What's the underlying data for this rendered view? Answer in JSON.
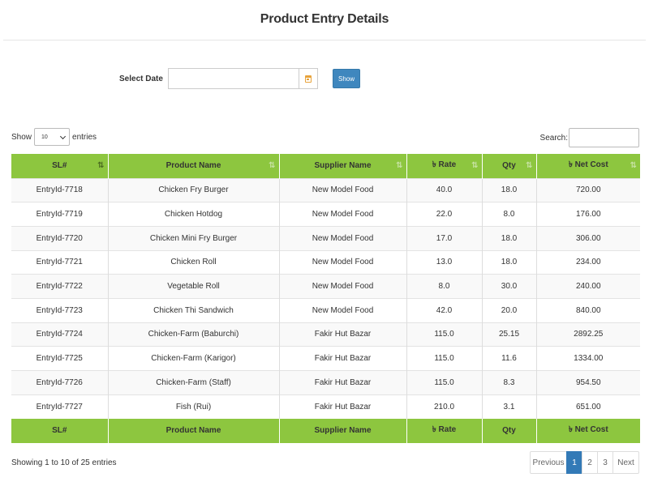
{
  "page": {
    "title": "Product Entry Details"
  },
  "filter": {
    "date_label": "Select Date",
    "date_value": "",
    "calendar_icon": "calendar-icon",
    "show_label": "Show"
  },
  "table_controls": {
    "show_prefix": "Show",
    "show_value": "10",
    "show_suffix": "entries",
    "search_label": "Search:",
    "search_value": ""
  },
  "columns": [
    "SL#",
    "Product Name",
    "Supplier Name",
    "৳ Rate",
    "Qty",
    "৳ Net Cost"
  ],
  "rows": [
    [
      "EntryId-7718",
      "Chicken Fry Burger",
      "New Model Food",
      "40.0",
      "18.0",
      "720.00"
    ],
    [
      "EntryId-7719",
      "Chicken Hotdog",
      "New Model Food",
      "22.0",
      "8.0",
      "176.00"
    ],
    [
      "EntryId-7720",
      "Chicken Mini Fry Burger",
      "New Model Food",
      "17.0",
      "18.0",
      "306.00"
    ],
    [
      "EntryId-7721",
      "Chicken Roll",
      "New Model Food",
      "13.0",
      "18.0",
      "234.00"
    ],
    [
      "EntryId-7722",
      "Vegetable Roll",
      "New Model Food",
      "8.0",
      "30.0",
      "240.00"
    ],
    [
      "EntryId-7723",
      "Chicken Thi Sandwich",
      "New Model Food",
      "42.0",
      "20.0",
      "840.00"
    ],
    [
      "EntryId-7724",
      "Chicken-Farm (Baburchi)",
      "Fakir Hut Bazar",
      "115.0",
      "25.15",
      "2892.25"
    ],
    [
      "EntryId-7725",
      "Chicken-Farm (Karigor)",
      "Fakir Hut Bazar",
      "115.0",
      "11.6",
      "1334.00"
    ],
    [
      "EntryId-7726",
      "Chicken-Farm (Staff)",
      "Fakir Hut Bazar",
      "115.0",
      "8.3",
      "954.50"
    ],
    [
      "EntryId-7727",
      "Fish (Rui)",
      "Fakir Hut Bazar",
      "210.0",
      "3.1",
      "651.00"
    ]
  ],
  "footer": {
    "info": "Showing 1 to 10 of 25 entries",
    "pagination": {
      "previous": "Previous",
      "pages": [
        "1",
        "2",
        "3"
      ],
      "active_page": "1",
      "next": "Next"
    }
  },
  "colors": {
    "header_green": "#8dc63f",
    "button_blue": "#3f87be",
    "active_page_blue": "#337ab7",
    "calendar_orange": "#e8a33b"
  }
}
